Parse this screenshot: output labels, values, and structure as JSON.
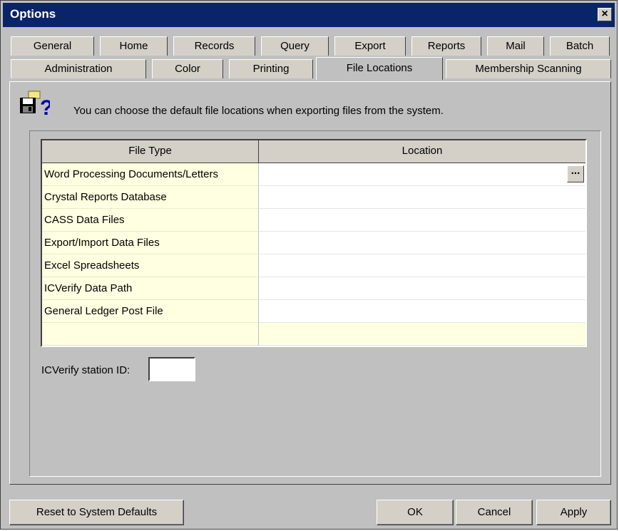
{
  "window": {
    "title": "Options",
    "close_glyph": "×"
  },
  "tabs_row1": [
    {
      "label": "General"
    },
    {
      "label": "Home"
    },
    {
      "label": "Records"
    },
    {
      "label": "Query"
    },
    {
      "label": "Export"
    },
    {
      "label": "Reports"
    },
    {
      "label": "Mail"
    },
    {
      "label": "Batch"
    }
  ],
  "tabs_row2": [
    {
      "label": "Administration"
    },
    {
      "label": "Color"
    },
    {
      "label": "Printing"
    },
    {
      "label": "File Locations",
      "selected": true
    },
    {
      "label": "Membership Scanning"
    }
  ],
  "info": {
    "icon": "disk-question-icon",
    "text": "You can choose the default file locations when exporting files from the system."
  },
  "grid": {
    "columns": [
      "File Type",
      "Location"
    ],
    "rows": [
      {
        "type": "Word Processing Documents/Letters",
        "location": ""
      },
      {
        "type": "Crystal Reports Database",
        "location": ""
      },
      {
        "type": "CASS Data Files",
        "location": ""
      },
      {
        "type": "Export/Import Data Files",
        "location": ""
      },
      {
        "type": "Excel Spreadsheets",
        "location": ""
      },
      {
        "type": "ICVerify Data Path",
        "location": ""
      },
      {
        "type": "General Ledger Post File",
        "location": ""
      },
      {
        "type": "",
        "location": ""
      }
    ],
    "browse_label": "..."
  },
  "station": {
    "label": "ICVerify station ID:",
    "value": ""
  },
  "buttons": {
    "reset": "Reset to System Defaults",
    "ok": "OK",
    "cancel": "Cancel",
    "apply": "Apply"
  },
  "colors": {
    "titlebar": "#0a246a",
    "window_bg": "#c0c0c0",
    "file_type_bg": "#ffffe1"
  }
}
